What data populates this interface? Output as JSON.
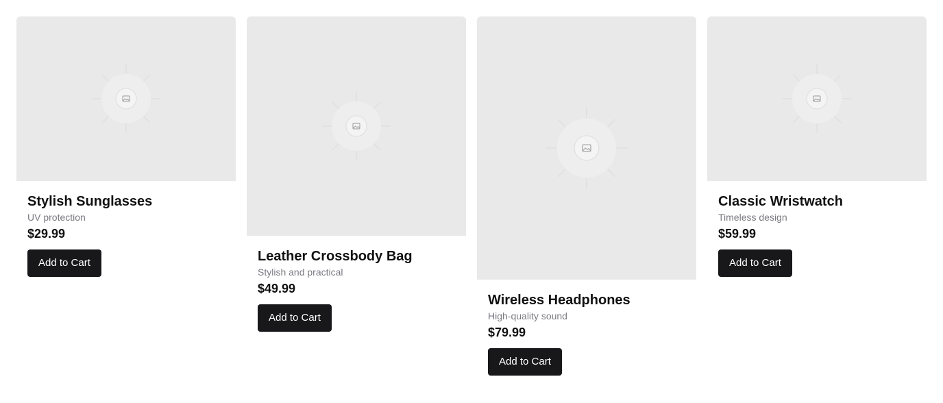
{
  "products": [
    {
      "title": "Stylish Sunglasses",
      "subtitle": "UV protection",
      "price": "$29.99",
      "button": "Add to Cart",
      "image_icon": "image-placeholder-icon"
    },
    {
      "title": "Leather Crossbody Bag",
      "subtitle": "Stylish and practical",
      "price": "$49.99",
      "button": "Add to Cart",
      "image_icon": "image-placeholder-icon"
    },
    {
      "title": "Wireless Headphones",
      "subtitle": "High-quality sound",
      "price": "$79.99",
      "button": "Add to Cart",
      "image_icon": "image-placeholder-icon"
    },
    {
      "title": "Classic Wristwatch",
      "subtitle": "Timeless design",
      "price": "$59.99",
      "button": "Add to Cart",
      "image_icon": "image-placeholder-icon"
    }
  ],
  "colors": {
    "image_bg": "#e9e9e9",
    "button_bg": "#18181b",
    "button_text": "#ffffff",
    "subtitle": "#7a7a82",
    "title": "#111111"
  }
}
